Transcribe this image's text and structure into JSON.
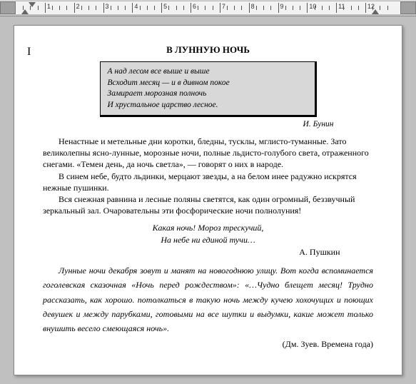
{
  "ruler": {
    "labels": [
      "1",
      "2",
      "3",
      "4",
      "5",
      "6",
      "7",
      "8",
      "9",
      "10",
      "11",
      "12"
    ]
  },
  "document": {
    "title": "В ЛУННУЮ НОЧЬ",
    "epigraph": {
      "lines": [
        "А над лесом все выше и выше",
        "Всходит месяц — и в дивном покое",
        "Замирает морозная полночь",
        "И хрустальное царство лесное."
      ],
      "author": "И. Бунин"
    },
    "paragraphs": [
      "Ненастные и метельные дни коротки, бледны, тусклы, мглисто-туманные. Зато великолепны ясно-лунные, морозные ночи, полные льдисто-голубого света, отраженного снегами. «Темен день, да ночь светла», — говорят о них в народе.",
      "В синем небе, будто льдинки, мерцают звезды, а на белом инее радужно искрятся нежные пушинки.",
      "Вся снежная равнина и лесные поляны светятся, как один огромный, беззвучный зеркальный зал. Очаровательны эти фосфорические ночи полнолуния!"
    ],
    "verse": {
      "lines": [
        "Какая ночь! Мороз трескучий,",
        "На небе ни единой тучи…"
      ],
      "author": "А. Пушкин"
    },
    "paragraph2": "Лунные ночи декабря зовут и манят на новогоднюю улицу. Вот когда вспоминается гоголевская сказочная «Ночь перед рождеством»: «…Чудно блещет месяц! Трудно рассказать, как хорошо. потолкаться в такую ночь между кучею хохочущих и поющих девушек и между парубками, готовыми на все шутки и выдумки, какие может только внушить весело смеющаяся ночь».",
    "source": "(Дм. Зуев. Времена года)"
  }
}
